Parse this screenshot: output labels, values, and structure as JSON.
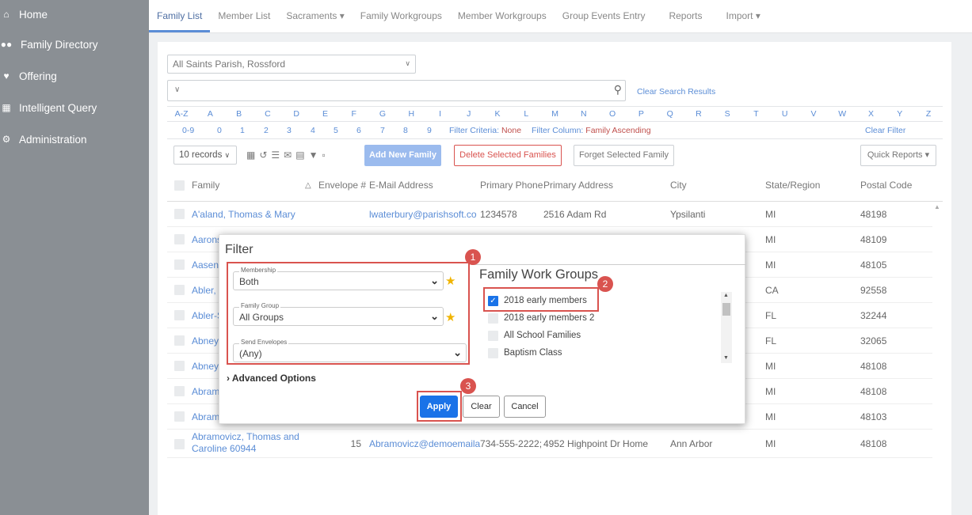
{
  "sidebar": {
    "items": [
      {
        "label": "Home",
        "icon": "home-icon"
      },
      {
        "label": "Family Directory",
        "icon": "users-icon"
      },
      {
        "label": "Offering",
        "icon": "heart-icon"
      },
      {
        "label": "Intelligent Query",
        "icon": "query-icon"
      },
      {
        "label": "Administration",
        "icon": "gear-icon"
      }
    ]
  },
  "topnav": {
    "tabs": [
      "Family List",
      "Member List",
      "Sacraments ▾",
      "Family Workgroups",
      "Member Workgroups",
      "Group Events Entry",
      "Reports",
      "Import ▾"
    ],
    "active": "Family List"
  },
  "filters": {
    "parish": "All Saints Parish, Rossford",
    "clear_search": "Clear Search Results",
    "alpha": [
      "A-Z",
      "A",
      "B",
      "C",
      "D",
      "E",
      "F",
      "G",
      "H",
      "I",
      "J",
      "K",
      "L",
      "M",
      "N",
      "O",
      "P",
      "Q",
      "R",
      "S",
      "T",
      "U",
      "V",
      "W",
      "X",
      "Y",
      "Z"
    ],
    "numbers": [
      "0-9",
      "0",
      "1",
      "2",
      "3",
      "4",
      "5",
      "6",
      "7",
      "8",
      "9"
    ],
    "criteria_label": "Filter Criteria:",
    "criteria_value": "None",
    "column_label": "Filter Column:",
    "column_value": "Family Ascending",
    "clear_filter": "Clear Filter"
  },
  "toolbar": {
    "records": "10 records",
    "add_label": "Add New Family",
    "delete_label": "Delete Selected Families",
    "forget_label": "Forget Selected Family",
    "quick_label": "Quick Reports ▾"
  },
  "table": {
    "headers": [
      "Family",
      "Envelope #",
      "E-Mail Address",
      "Primary Phone",
      "Primary Address",
      "City",
      "State/Region",
      "Postal Code"
    ],
    "rows": [
      {
        "family": "A'aland, Thomas & Mary",
        "envelope": "",
        "email": "lwaterbury@parishsoft.co",
        "phone": "1234578",
        "address": "2516 Adam Rd",
        "city": "Ypsilanti",
        "state": "MI",
        "zip": "48198"
      },
      {
        "family": "Aarons",
        "state": "MI",
        "zip": "48109"
      },
      {
        "family": "Aasen",
        "state": "MI",
        "zip": "48105"
      },
      {
        "family": "Abler,",
        "state": "CA",
        "zip": "92558"
      },
      {
        "family": "Abler-S",
        "state": "FL",
        "zip": "32244"
      },
      {
        "family": "Abney",
        "state": "FL",
        "zip": "32065"
      },
      {
        "family": "Abney",
        "state": "MI",
        "zip": "48108"
      },
      {
        "family": "Abram",
        "state": "MI",
        "zip": "48108"
      },
      {
        "family": "Abram",
        "state": "MI",
        "zip": "48103"
      },
      {
        "family": "Abramovicz, Thomas and Caroline 60944",
        "envelope": "15",
        "email": "Abramovicz@demoemaila",
        "phone": "734-555-2222;",
        "address": "4952 Highpoint Dr Home",
        "city": "Ann Arbor",
        "state": "MI",
        "zip": "48108"
      }
    ]
  },
  "modal": {
    "title": "Filter",
    "membership_label": "Membership",
    "membership_value": "Both",
    "family_group_label": "Family Group",
    "family_group_value": "All Groups",
    "send_env_label": "Send Envelopes",
    "send_env_value": "(Any)",
    "advanced": "Advanced Options",
    "fwg_title": "Family Work Groups",
    "fwg_items": [
      {
        "label": "2018 early members",
        "checked": true
      },
      {
        "label": "2018 early members 2",
        "checked": false
      },
      {
        "label": "All School Families",
        "checked": false
      },
      {
        "label": "Baptism Class",
        "checked": false
      }
    ],
    "apply": "Apply",
    "clear": "Clear",
    "cancel": "Cancel",
    "badges": [
      "1",
      "2",
      "3"
    ]
  }
}
